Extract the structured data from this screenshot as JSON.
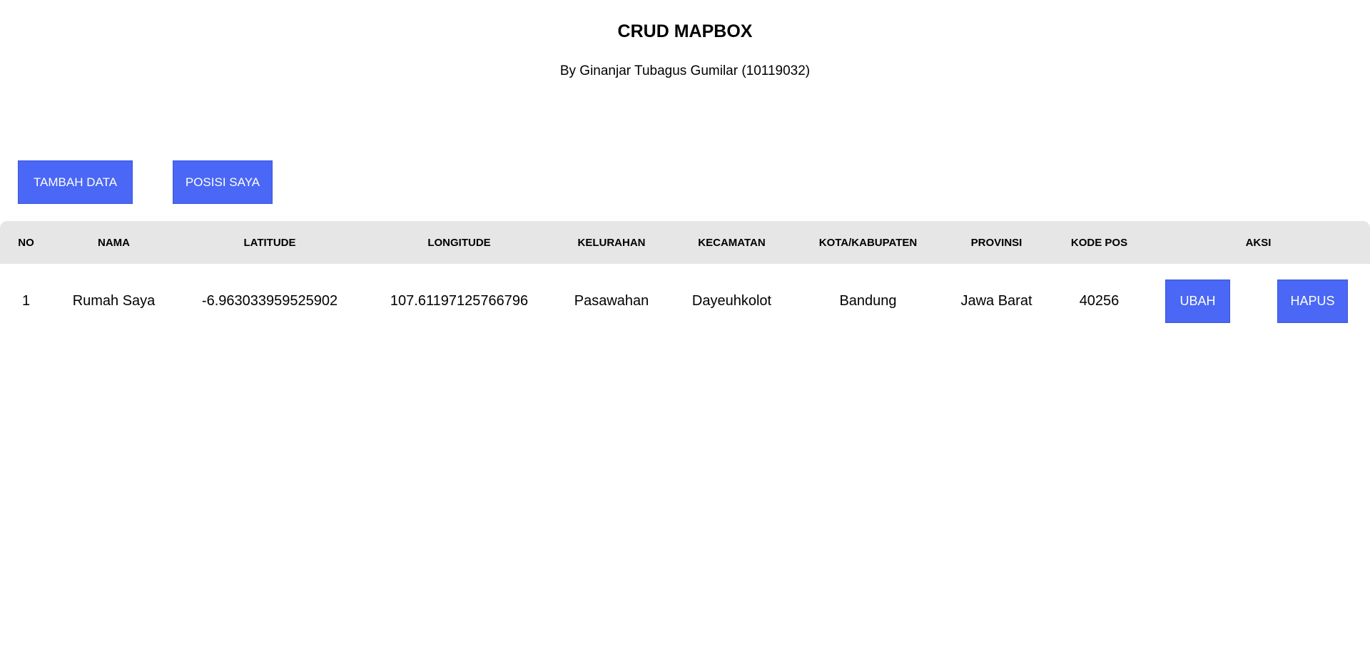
{
  "header": {
    "title": "CRUD MAPBOX",
    "subtitle": "By Ginanjar Tubagus Gumilar (10119032)"
  },
  "toolbar": {
    "add_label": "TAMBAH DATA",
    "position_label": "POSISI SAYA"
  },
  "table": {
    "columns": [
      "NO",
      "NAMA",
      "LATITUDE",
      "LONGITUDE",
      "KELURAHAN",
      "KECAMATAN",
      "KOTA/KABUPATEN",
      "PROVINSI",
      "KODE POS",
      "AKSI"
    ],
    "rows": [
      {
        "no": "1",
        "nama": "Rumah Saya",
        "latitude": "-6.963033959525902",
        "longitude": "107.61197125766796",
        "kelurahan": "Pasawahan",
        "kecamatan": "Dayeuhkolot",
        "kota": "Bandung",
        "provinsi": "Jawa Barat",
        "kode_pos": "40256",
        "edit_label": "UBAH",
        "delete_label": "HAPUS"
      }
    ]
  },
  "colors": {
    "button": "#4a67f5",
    "header_bg": "#e6e6e6"
  }
}
